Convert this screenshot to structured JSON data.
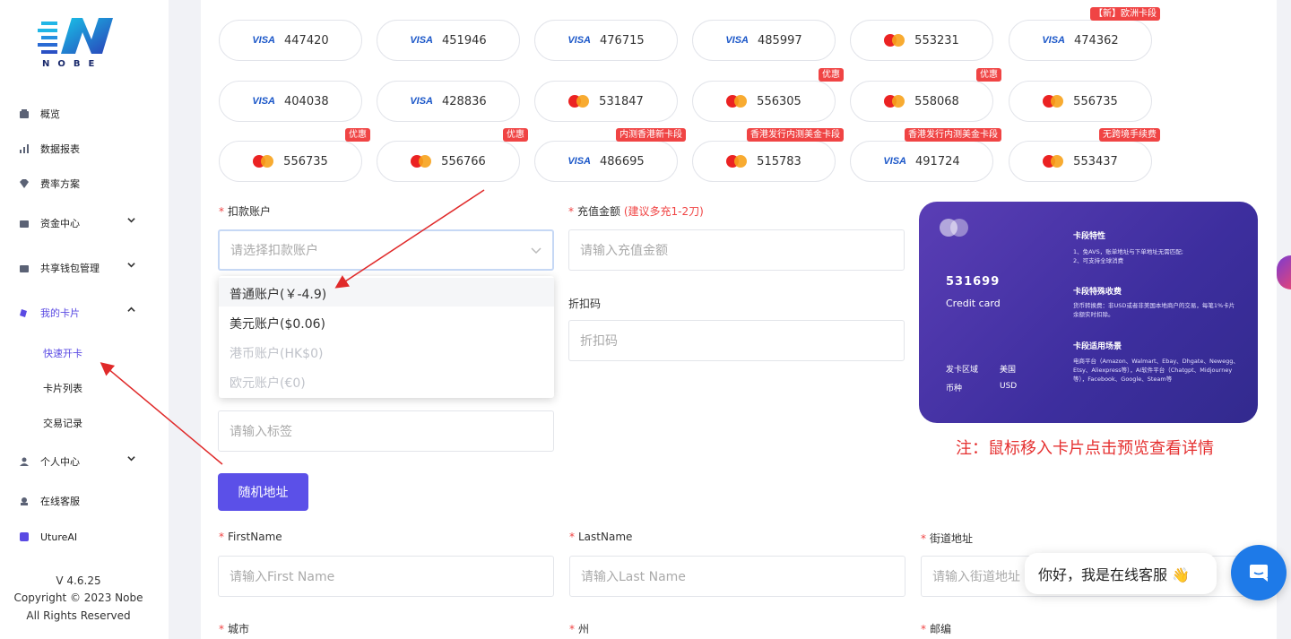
{
  "sidebar": {
    "logo_text": "NOBE",
    "items": [
      {
        "label": "概览",
        "icon": "dashboard-icon"
      },
      {
        "label": "数据报表",
        "icon": "chart-icon"
      },
      {
        "label": "费率方案",
        "icon": "diamond-icon"
      },
      {
        "label": "资金中心",
        "icon": "wallet-icon",
        "chevron": "down"
      },
      {
        "label": "共享钱包管理",
        "icon": "share-wallet-icon",
        "chevron": "down"
      },
      {
        "label": "我的卡片",
        "icon": "card-icon",
        "chevron": "up",
        "active": true
      },
      {
        "label": "个人中心",
        "icon": "user-icon",
        "chevron": "down"
      },
      {
        "label": "在线客服",
        "icon": "support-icon"
      },
      {
        "label": "UtureAI",
        "icon": "ai-icon"
      }
    ],
    "sub_items": [
      "快速开卡",
      "卡片列表",
      "交易记录"
    ],
    "version": "V 4.6.25",
    "copyright": "Copyright © 2023 Nobe",
    "rights": "All Rights Reserved"
  },
  "bins": {
    "row1": [
      {
        "brand": "visa",
        "number": "447420"
      },
      {
        "brand": "visa",
        "number": "451946"
      },
      {
        "brand": "visa",
        "number": "476715"
      },
      {
        "brand": "visa",
        "number": "485997"
      },
      {
        "brand": "mastercard",
        "number": "553231"
      },
      {
        "brand": "visa",
        "number": "474362",
        "badge": "【新】欧洲卡段"
      }
    ],
    "row2": [
      {
        "brand": "visa",
        "number": "404038"
      },
      {
        "brand": "visa",
        "number": "428836"
      },
      {
        "brand": "mastercard",
        "number": "531847"
      },
      {
        "brand": "mastercard",
        "number": "556305",
        "badge": "优惠"
      },
      {
        "brand": "mastercard",
        "number": "558068",
        "badge": "优惠"
      },
      {
        "brand": "mastercard",
        "number": "556735"
      }
    ],
    "row3": [
      {
        "brand": "mastercard",
        "number": "556735",
        "badge": "优惠"
      },
      {
        "brand": "mastercard",
        "number": "556766",
        "badge": "优惠"
      },
      {
        "brand": "visa",
        "number": "486695",
        "badge": "内测香港新卡段"
      },
      {
        "brand": "mastercard",
        "number": "515783",
        "badge": "香港发行内测美金卡段"
      },
      {
        "brand": "visa",
        "number": "491724",
        "badge": "香港发行内测美金卡段"
      },
      {
        "brand": "mastercard",
        "number": "553437",
        "badge": "无跨境手续费"
      }
    ]
  },
  "brand_labels": {
    "visa": "VISA"
  },
  "form": {
    "debit_account_label": "扣款账户",
    "debit_account_placeholder": "请选择扣款账户",
    "recharge_label": "充值金额",
    "recharge_hint": "(建议多充1-2刀)",
    "recharge_placeholder": "请输入充值金额",
    "discount_label": "折扣码",
    "discount_placeholder": "折扣码",
    "tag_placeholder": "请输入标签",
    "random_address_button": "随机地址",
    "firstname_label": "FirstName",
    "firstname_placeholder": "请输入First Name",
    "lastname_label": "LastName",
    "lastname_placeholder": "请输入Last Name",
    "street_label": "街道地址",
    "street_placeholder": "请输入街道地址",
    "city_label": "城市",
    "state_label": "州",
    "zip_label": "邮编"
  },
  "dropdown_options": [
    {
      "label": "普通账户(￥-4.9)",
      "disabled": false
    },
    {
      "label": "美元账户($0.06)",
      "disabled": false
    },
    {
      "label": "港币账户(HK$0)",
      "disabled": true
    },
    {
      "label": "欧元账户(€0)",
      "disabled": true
    }
  ],
  "card_preview": {
    "bin": "531699",
    "type": "Credit card",
    "region_label": "发卡区域",
    "region_value": "美国",
    "currency_label": "币种",
    "currency_value": "USD",
    "features_title": "卡段特性",
    "features_text": "1、免AVS，账单地址与下单地址无需匹配;\n2、可支持全球消费",
    "fees_title": "卡段特殊收费",
    "fees_text": "货币转换费：非USD或者非美国本地商户的交易，每笔1%卡片余额实时扣除。",
    "scenes_title": "卡段适用场景",
    "scenes_text": "电商平台（Amazon、Walmart、Ebay、Dhgate、Newegg、Etsy、Aliexpress等），AI软件平台（Chatgpt、Midjourney等），Facebook、Google、Steam等"
  },
  "note": "注：鼠标移入卡片点击预览查看详情",
  "chat": {
    "greeting": "你好，我是在线客服 👋"
  },
  "colors": {
    "primary": "#5b50e8",
    "danger": "#f04444",
    "card_bg": "#3d2e9e",
    "chat": "#1e7ae8"
  }
}
